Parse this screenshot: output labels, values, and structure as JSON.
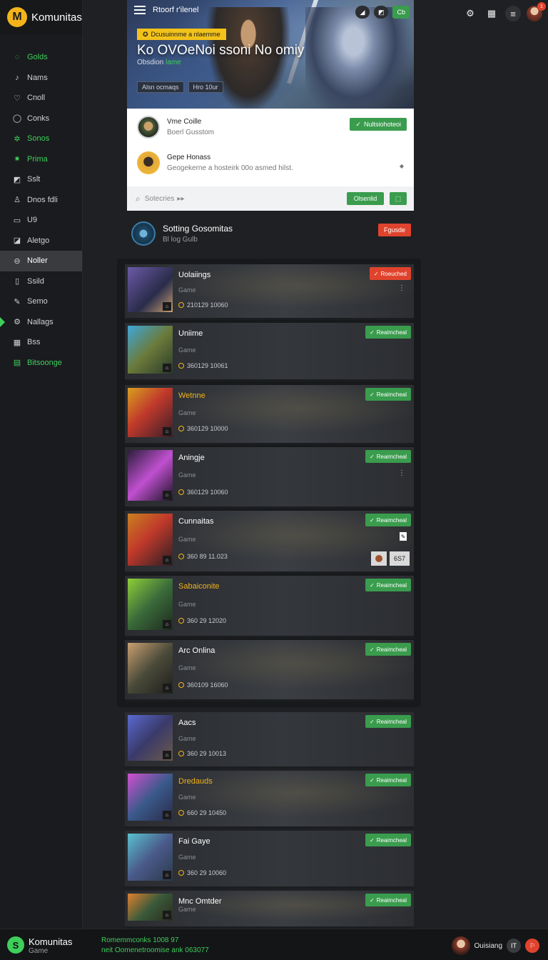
{
  "brand": {
    "name": "Komunitas",
    "logo_letter": "M"
  },
  "nav": [
    {
      "label": "Golds",
      "icon": "circle-icon",
      "color": "#3ecf5b"
    },
    {
      "label": "Nams",
      "icon": "music-icon"
    },
    {
      "label": "Cnoll",
      "icon": "heart-icon"
    },
    {
      "label": "Conks",
      "icon": "chat-icon"
    },
    {
      "label": "Sonos",
      "icon": "star-icon",
      "color": "#3ecf5b"
    },
    {
      "label": "Prima",
      "icon": "spark-icon",
      "color": "#3ecf5b"
    },
    {
      "label": "Sslt",
      "icon": "chart-icon"
    },
    {
      "label": "Dnos fdli",
      "icon": "user-icon"
    },
    {
      "label": "U9",
      "icon": "box-icon"
    },
    {
      "label": "Aletgo",
      "icon": "lock-icon"
    },
    {
      "label": "Noller",
      "icon": "globe-icon",
      "selected": true
    },
    {
      "label": "Ssild",
      "icon": "doc-icon"
    },
    {
      "label": "Semo",
      "icon": "pen-icon"
    },
    {
      "label": "Nallags",
      "icon": "gear-icon",
      "active": true
    },
    {
      "label": "Bss",
      "icon": "grid-icon"
    },
    {
      "label": "Bitsoonge",
      "icon": "list-icon",
      "cta": true
    }
  ],
  "top_right": {
    "notification_count": "1"
  },
  "hero": {
    "small_title": "Rtoorf r'ilenel",
    "badge": "Dcusuinnme a nlaemme",
    "title": "Ko OVOeNoi ssoni No omiy",
    "subtitle": "Obsdion",
    "subtitle_highlight": "lame",
    "tags": [
      "Alsn ocmaqs",
      "Hro 10ur"
    ],
    "action_label": "Cb"
  },
  "panel": {
    "user1": {
      "name": "Vme Coille",
      "sub": "Boerl Gusstom"
    },
    "follow_label": "Nultsiohoteoi",
    "user2": {
      "name": "Gepe Honass",
      "sub": "Geogekerne a hosteirk 00o asmed hilst."
    },
    "search_placeholder": "Sotecries",
    "search_btn": "Olsenlid"
  },
  "section": {
    "title": "Sotting Gosomitas",
    "subtitle": "Bl log Gulb",
    "button": "Fgusde"
  },
  "cards": [
    {
      "title": "Uolaiings",
      "genre": "Game",
      "stat": "210129 10060",
      "btn": "Roeuched",
      "btn_red": true,
      "yellow": false
    },
    {
      "title": "Uniime",
      "genre": "Game",
      "stat": "360129 10061",
      "btn": "Reaimcheal",
      "btn_red": false,
      "yellow": false
    },
    {
      "title": "Wetnne",
      "genre": "Game",
      "stat": "360129 10000",
      "btn": "Reaimcheal",
      "btn_red": false,
      "yellow": true
    },
    {
      "title": "Aningje",
      "genre": "Game",
      "stat": "360129 10060",
      "btn": "Reaimcheal",
      "btn_red": false,
      "yellow": false
    },
    {
      "title": "Cunnaitas",
      "genre": "Game",
      "stat": "360 89 11.023",
      "btn": "Reaimcheal",
      "btn_red": false,
      "yellow": false,
      "extra_tag": "6S7"
    },
    {
      "title": "Sabaiconite",
      "genre": "Game",
      "stat": "360 29 12020",
      "btn": "Reaimcheal",
      "btn_red": false,
      "yellow": true
    },
    {
      "title": "Arc Onlina",
      "genre": "Game",
      "stat": "360109 16060",
      "btn": "Reaimcheal",
      "btn_red": false,
      "yellow": false
    },
    {
      "title": "Aacs",
      "genre": "Game",
      "stat": "360 29 10013",
      "btn": "Reaimcheal",
      "btn_red": false,
      "yellow": false
    },
    {
      "title": "Dredauds",
      "genre": "Game",
      "stat": "660 29 10450",
      "btn": "Reaimcheal",
      "btn_red": false,
      "yellow": true
    },
    {
      "title": "Fai Gaye",
      "genre": "Game",
      "stat": "360 29 10060",
      "btn": "Reaimcheal",
      "btn_red": false,
      "yellow": false
    },
    {
      "title": "Mnc Omtder",
      "genre": "Game",
      "stat": "",
      "btn": "Reaimcheal",
      "btn_red": false,
      "yellow": false
    }
  ],
  "bottom": {
    "name": "Komunitas",
    "sub": "Game",
    "line1": "Romemmconks 1008 97",
    "line2": "neit Oomenetroomise ank 063077",
    "user": "Ouisiang",
    "badge": "IT"
  }
}
